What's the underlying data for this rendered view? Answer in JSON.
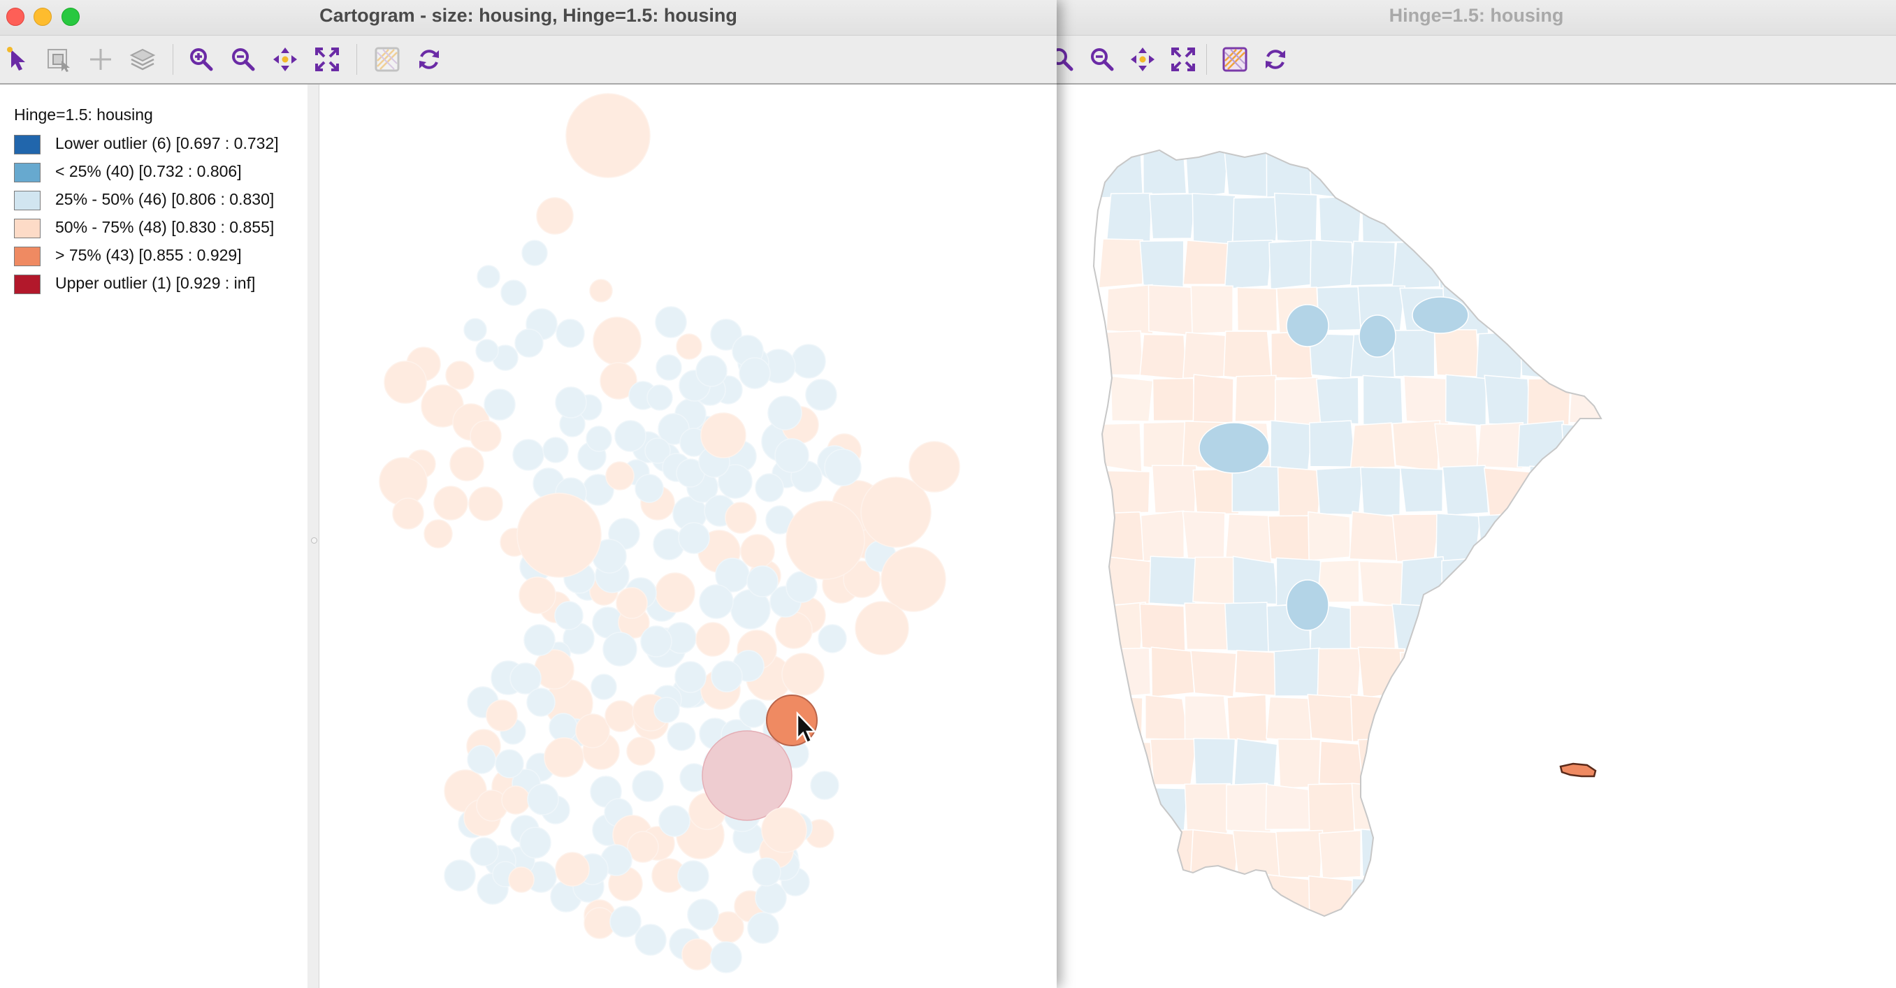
{
  "colors": {
    "lower_outlier": "#2166ac",
    "lt25": "#67a9cf",
    "p25_50": "#d1e5f0",
    "p50_75": "#fddbc7",
    "gt75": "#ef8a62",
    "upper_outlier": "#b2182b"
  },
  "cartogram_window": {
    "title": "Cartogram - size: housing, Hinge=1.5: housing",
    "toolbar": [
      "select-arrow-icon",
      "select-region-icon",
      "add-crosshair-icon",
      "layers-icon",
      "zoom-in-icon",
      "zoom-out-icon",
      "pan-icon",
      "full-extent-icon",
      "basemap-icon",
      "refresh-icon"
    ],
    "legend": {
      "title": "Hinge=1.5: housing",
      "items": [
        {
          "label": "Lower outlier (6)  [0.697 : 0.732]",
          "color": "#2166ac"
        },
        {
          "label": "< 25% (40)  [0.732 : 0.806]",
          "color": "#67a9cf"
        },
        {
          "label": "25% - 50% (46)  [0.806 : 0.830]",
          "color": "#d1e5f0"
        },
        {
          "label": "50% - 75% (48)  [0.830 : 0.855]",
          "color": "#fddbc7"
        },
        {
          "label": "> 75% (43)  [0.855 : 0.929]",
          "color": "#ef8a62"
        },
        {
          "label": "Upper outlier (1)  [0.929 : inf]",
          "color": "#b2182b"
        }
      ]
    }
  },
  "map_window": {
    "title": "Hinge=1.5: housing",
    "toolbar": [
      "zoom-in-icon",
      "zoom-out-icon",
      "pan-icon",
      "full-extent-icon",
      "basemap-icon",
      "refresh-icon"
    ]
  }
}
